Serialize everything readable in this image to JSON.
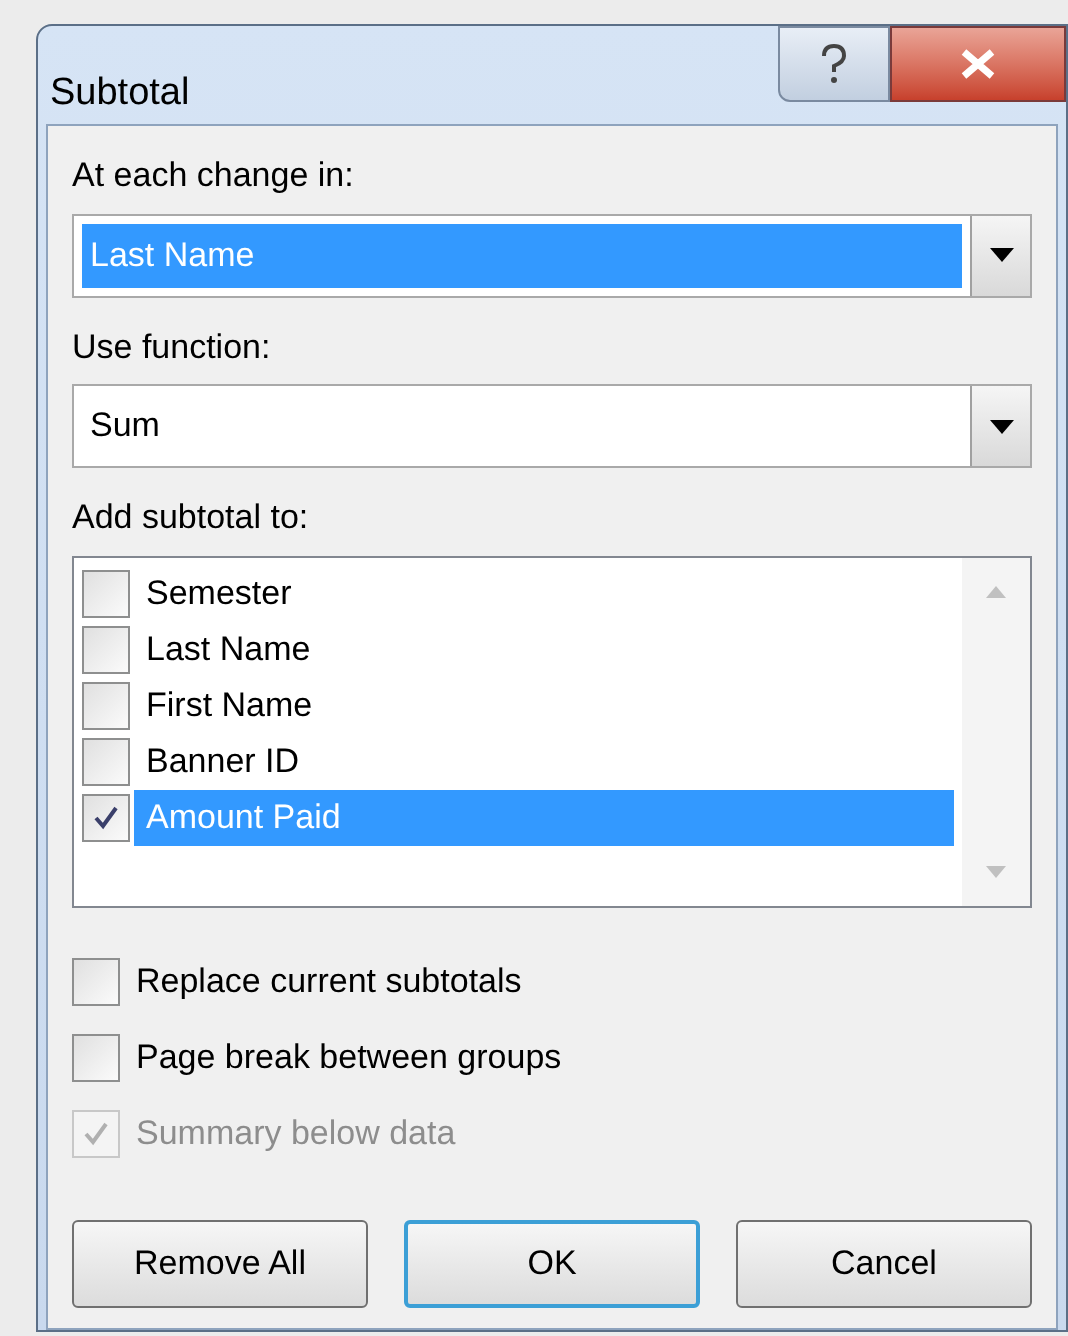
{
  "window": {
    "title": "Subtotal"
  },
  "change_in": {
    "label": "At each change in:",
    "value": "Last Name",
    "selected": true
  },
  "function": {
    "label": "Use function:",
    "value": "Sum",
    "selected": false
  },
  "add_subtotal": {
    "label": "Add subtotal to:",
    "items": [
      {
        "label": "Semester",
        "checked": false,
        "selected": false
      },
      {
        "label": "Last Name",
        "checked": false,
        "selected": false
      },
      {
        "label": "First Name",
        "checked": false,
        "selected": false
      },
      {
        "label": "Banner ID",
        "checked": false,
        "selected": false
      },
      {
        "label": "Amount Paid",
        "checked": true,
        "selected": true
      }
    ]
  },
  "options": [
    {
      "label": "Replace current subtotals",
      "checked": false,
      "disabled": false
    },
    {
      "label": "Page break between groups",
      "checked": false,
      "disabled": false
    },
    {
      "label": "Summary below data",
      "checked": true,
      "disabled": true
    }
  ],
  "buttons": [
    {
      "label": "Remove All",
      "default": false
    },
    {
      "label": "OK",
      "default": true
    },
    {
      "label": "Cancel",
      "default": false
    }
  ]
}
